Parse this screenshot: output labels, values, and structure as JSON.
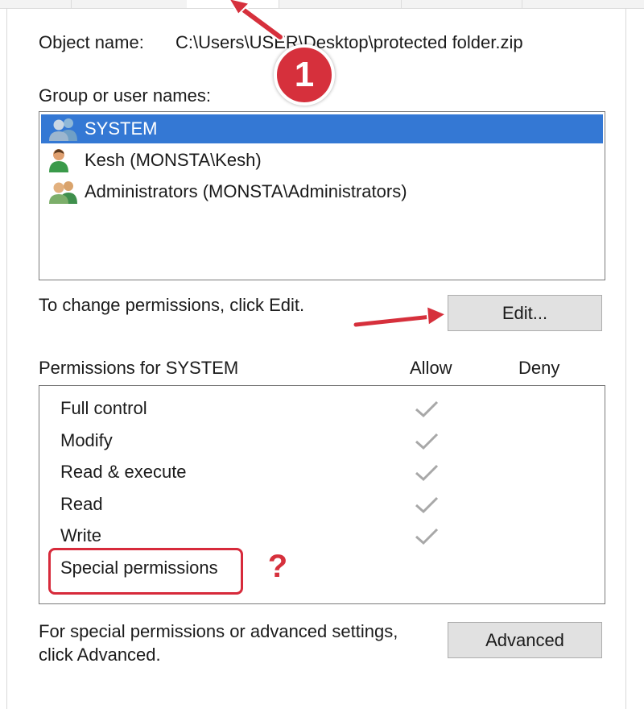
{
  "object_name": {
    "label": "Object name:",
    "value": "C:\\Users\\USER\\Desktop\\protected folder.zip"
  },
  "group_label": "Group or user names:",
  "users": [
    {
      "name": "SYSTEM",
      "icon": "user-group-icon",
      "selected": true
    },
    {
      "name": "Kesh (MONSTA\\Kesh)",
      "icon": "user-icon",
      "selected": false
    },
    {
      "name": "Administrators (MONSTA\\Administrators)",
      "icon": "user-group-icon",
      "selected": false
    }
  ],
  "change_hint": "To change permissions, click Edit.",
  "edit_button": "Edit...",
  "permissions": {
    "header": "Permissions for SYSTEM",
    "allow_label": "Allow",
    "deny_label": "Deny",
    "rows": [
      {
        "name": "Full control",
        "allow": true
      },
      {
        "name": "Modify",
        "allow": true
      },
      {
        "name": "Read & execute",
        "allow": true
      },
      {
        "name": "Read",
        "allow": true
      },
      {
        "name": "Write",
        "allow": true
      },
      {
        "name": "Special permissions",
        "allow": false
      }
    ]
  },
  "advanced_hint": {
    "line1": "For special permissions or advanced settings,",
    "line2": "click Advanced."
  },
  "advanced_button": "Advanced",
  "annotations": {
    "step_badge": "1",
    "question_mark": "?",
    "accent_color": "#d6303c",
    "selection_color": "#3478d4"
  }
}
